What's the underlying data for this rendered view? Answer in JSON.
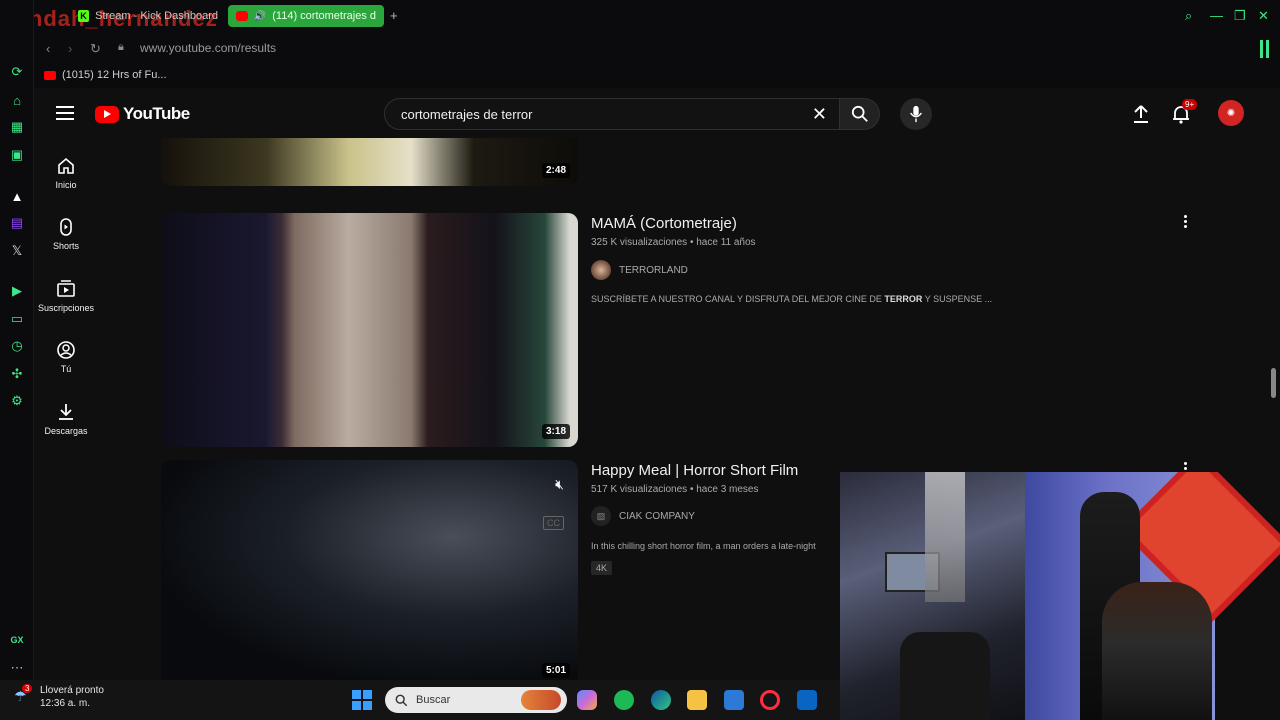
{
  "browser": {
    "overlay_text": "Pandah_hernandez",
    "tabs": [
      {
        "label": "Stream - Kick Dashboard"
      },
      {
        "label": "(114) cortometrajes d"
      }
    ],
    "url": "www.youtube.com/results",
    "bookmark": "(1015) 12 Hrs of Fu...",
    "gx_label": "GX"
  },
  "youtube": {
    "logo_text": "YouTube",
    "search_value": "cortometrajes de terror",
    "notifications_badge": "9+",
    "guide": [
      {
        "label": "Inicio"
      },
      {
        "label": "Shorts"
      },
      {
        "label": "Suscripciones"
      },
      {
        "label": "Tú"
      },
      {
        "label": "Descargas"
      }
    ]
  },
  "results": [
    {
      "duration": "2:48"
    },
    {
      "title": "MAMÁ (Cortometraje)",
      "views": "325 K visualizaciones",
      "age": "hace 11 años",
      "channel": "TERRORLAND",
      "description_pre": "SUSCRÍBETE A NUESTRO CANAL Y DISFRUTA DEL MEJOR CINE DE ",
      "description_bold": "TERROR",
      "description_post": " Y SUSPENSE ...",
      "duration": "3:18"
    },
    {
      "title": "Happy Meal | Horror Short Film",
      "views": "517 K visualizaciones",
      "age": "hace 3 meses",
      "channel": "CIAK COMPANY",
      "description": "In this chilling short horror film, a man orders a late-night",
      "badge": "4K",
      "duration": "5:01"
    }
  ],
  "taskbar": {
    "weather_title": "Lloverá pronto",
    "weather_time": "12:36 a. m.",
    "weather_badge": "3",
    "search_placeholder": "Buscar"
  },
  "colors": {
    "accent_gx": "#3fe58a",
    "youtube_red": "#ff0000",
    "background": "#0f0f0f"
  }
}
